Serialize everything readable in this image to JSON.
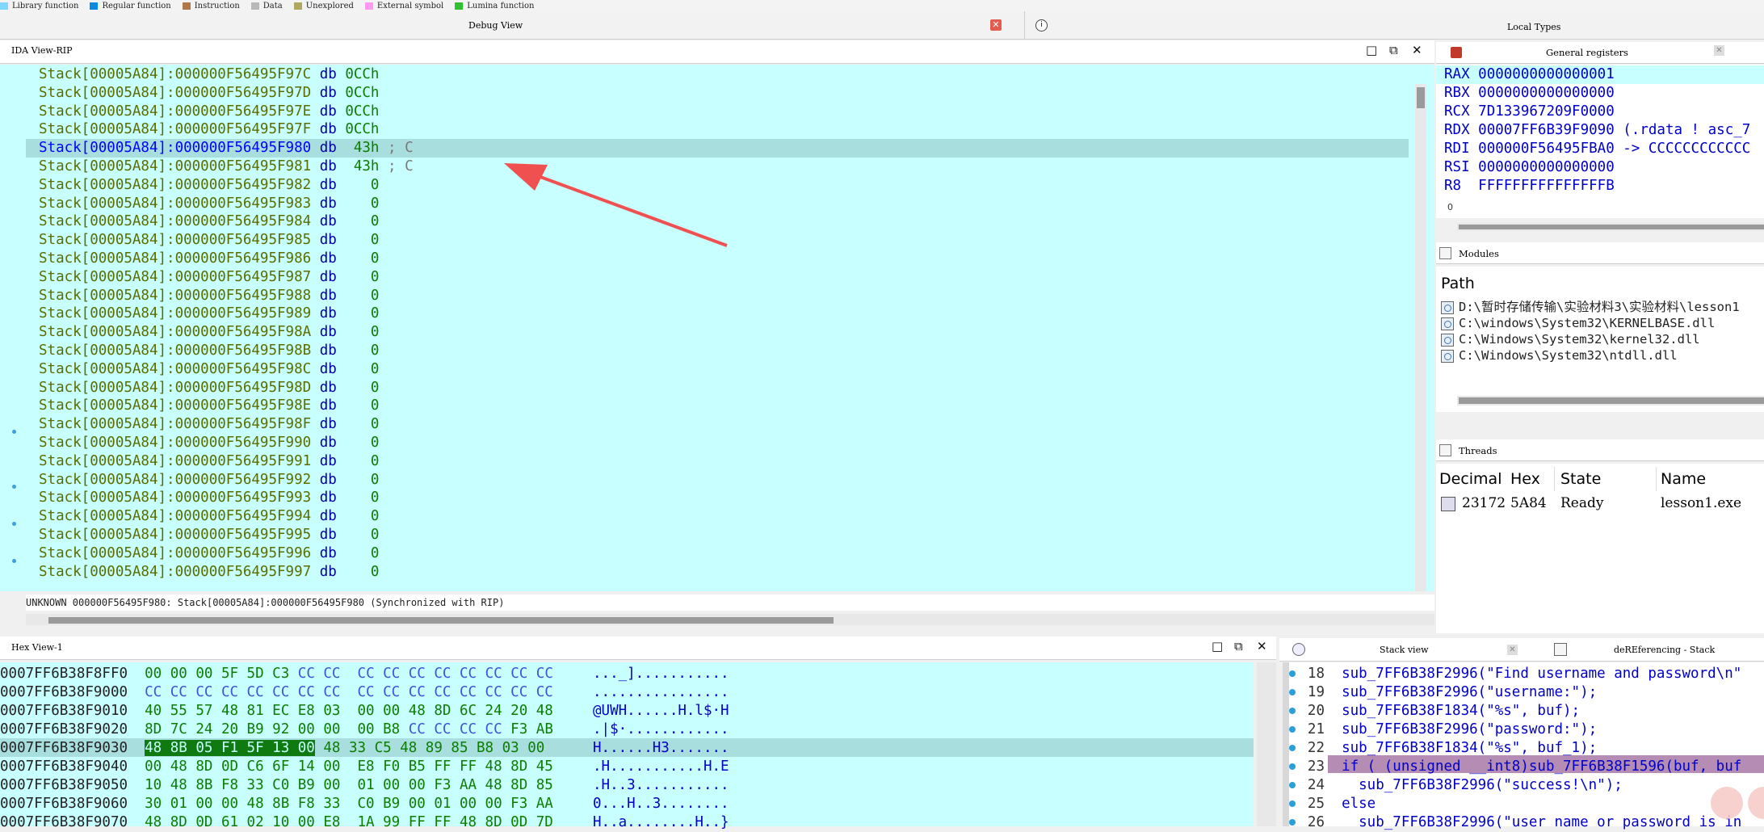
{
  "legend": [
    {
      "label": "Library function",
      "color": "#7fd6ff"
    },
    {
      "label": "Regular function",
      "color": "#0a8ae0"
    },
    {
      "label": "Instruction",
      "color": "#b07848"
    },
    {
      "label": "Data",
      "color": "#b8b8b8"
    },
    {
      "label": "Unexplored",
      "color": "#b0a860"
    },
    {
      "label": "External symbol",
      "color": "#ff98f0"
    },
    {
      "label": "Lumina function",
      "color": "#30c030"
    }
  ],
  "tabs": {
    "debug_view": "Debug View",
    "local_types": "Local Types",
    "close_glyph": "✕"
  },
  "ida_view": {
    "title": "IDA View-RIP",
    "lines": [
      {
        "addr": "Stack[00005A84]:000000F56495F97C",
        "op": "db",
        "val": "0CCh",
        "cmt": ""
      },
      {
        "addr": "Stack[00005A84]:000000F56495F97D",
        "op": "db",
        "val": "0CCh",
        "cmt": ""
      },
      {
        "addr": "Stack[00005A84]:000000F56495F97E",
        "op": "db",
        "val": "0CCh",
        "cmt": ""
      },
      {
        "addr": "Stack[00005A84]:000000F56495F97F",
        "op": "db",
        "val": "0CCh",
        "cmt": ""
      },
      {
        "addr": "Stack[00005A84]:000000F56495F980",
        "op": "db",
        "val": " 43h",
        "cmt": " ; C"
      },
      {
        "addr": "Stack[00005A84]:000000F56495F981",
        "op": "db",
        "val": " 43h",
        "cmt": " ; C"
      },
      {
        "addr": "Stack[00005A84]:000000F56495F982",
        "op": "db",
        "val": "   0",
        "cmt": ""
      },
      {
        "addr": "Stack[00005A84]:000000F56495F983",
        "op": "db",
        "val": "   0",
        "cmt": ""
      },
      {
        "addr": "Stack[00005A84]:000000F56495F984",
        "op": "db",
        "val": "   0",
        "cmt": ""
      },
      {
        "addr": "Stack[00005A84]:000000F56495F985",
        "op": "db",
        "val": "   0",
        "cmt": ""
      },
      {
        "addr": "Stack[00005A84]:000000F56495F986",
        "op": "db",
        "val": "   0",
        "cmt": ""
      },
      {
        "addr": "Stack[00005A84]:000000F56495F987",
        "op": "db",
        "val": "   0",
        "cmt": ""
      },
      {
        "addr": "Stack[00005A84]:000000F56495F988",
        "op": "db",
        "val": "   0",
        "cmt": ""
      },
      {
        "addr": "Stack[00005A84]:000000F56495F989",
        "op": "db",
        "val": "   0",
        "cmt": ""
      },
      {
        "addr": "Stack[00005A84]:000000F56495F98A",
        "op": "db",
        "val": "   0",
        "cmt": ""
      },
      {
        "addr": "Stack[00005A84]:000000F56495F98B",
        "op": "db",
        "val": "   0",
        "cmt": ""
      },
      {
        "addr": "Stack[00005A84]:000000F56495F98C",
        "op": "db",
        "val": "   0",
        "cmt": ""
      },
      {
        "addr": "Stack[00005A84]:000000F56495F98D",
        "op": "db",
        "val": "   0",
        "cmt": ""
      },
      {
        "addr": "Stack[00005A84]:000000F56495F98E",
        "op": "db",
        "val": "   0",
        "cmt": ""
      },
      {
        "addr": "Stack[00005A84]:000000F56495F98F",
        "op": "db",
        "val": "   0",
        "cmt": ""
      },
      {
        "addr": "Stack[00005A84]:000000F56495F990",
        "op": "db",
        "val": "   0",
        "cmt": ""
      },
      {
        "addr": "Stack[00005A84]:000000F56495F991",
        "op": "db",
        "val": "   0",
        "cmt": ""
      },
      {
        "addr": "Stack[00005A84]:000000F56495F992",
        "op": "db",
        "val": "   0",
        "cmt": ""
      },
      {
        "addr": "Stack[00005A84]:000000F56495F993",
        "op": "db",
        "val": "   0",
        "cmt": ""
      },
      {
        "addr": "Stack[00005A84]:000000F56495F994",
        "op": "db",
        "val": "   0",
        "cmt": ""
      },
      {
        "addr": "Stack[00005A84]:000000F56495F995",
        "op": "db",
        "val": "   0",
        "cmt": ""
      },
      {
        "addr": "Stack[00005A84]:000000F56495F996",
        "op": "db",
        "val": "   0",
        "cmt": ""
      },
      {
        "addr": "Stack[00005A84]:000000F56495F997",
        "op": "db",
        "val": "   0",
        "cmt": ""
      }
    ],
    "status": "UNKNOWN 000000F56495F980: Stack[00005A84]:000000F56495F980 (Synchronized with RIP)"
  },
  "registers": {
    "title": "General registers",
    "rows": [
      {
        "name": "RAX",
        "value": "0000000000000001",
        "comment": ""
      },
      {
        "name": "RBX",
        "value": "0000000000000000",
        "comment": ""
      },
      {
        "name": "RCX",
        "value": "7D133967209F0000",
        "comment": ""
      },
      {
        "name": "RDX",
        "value": "00007FF6B39F9090",
        "comment": " (.rdata ! asc_7"
      },
      {
        "name": "RDI",
        "value": "000000F56495FBA0",
        "comment": " -> CCCCCCCCCCCC"
      },
      {
        "name": "RSI",
        "value": "0000000000000000",
        "comment": ""
      },
      {
        "name": "R8 ",
        "value": "FFFFFFFFFFFFFFFB",
        "comment": ""
      }
    ],
    "footer": "0"
  },
  "modules": {
    "title": "Modules",
    "header": "Path",
    "paths": [
      "D:\\暂时存储传输\\实验材料3\\实验材料\\lesson1",
      "C:\\windows\\System32\\KERNELBASE.dll",
      "C:\\Windows\\System32\\kernel32.dll",
      "C:\\Windows\\System32\\ntdll.dll"
    ]
  },
  "threads": {
    "title": "Threads",
    "headers": [
      "Decimal",
      "Hex",
      "State",
      "Name"
    ],
    "row": {
      "decimal": "23172",
      "hex": "5A84",
      "state": "Ready",
      "name": "lesson1.exe"
    }
  },
  "hex_view": {
    "title": "Hex View-1",
    "rows": [
      {
        "addr": "0007FF6B38F8FF0",
        "b1": "00 00 00 5F 5D C3",
        "b2": " CC CC ",
        "b3": " CC CC CC CC CC CC CC CC",
        "asc": "..._]..........."
      },
      {
        "addr": "0007FF6B38F9000",
        "b1": "",
        "b2": "CC CC CC CC CC CC CC CC  CC CC CC CC CC CC CC CC",
        "b3": "",
        "asc": "................"
      },
      {
        "addr": "0007FF6B38F9010",
        "b1": "40 55 57 48 81 EC E8 03  00 00 48 8D 6C 24 20 48",
        "b2": "",
        "b3": "",
        "asc": "@UWH......H.l$·H"
      },
      {
        "addr": "0007FF6B38F9020",
        "b1": "8D 7C 24 20 B9 92 00 00  00 B8",
        "b2": " CC CC CC CC",
        "b3": " F3 AB",
        "asc": ".|$·............"
      },
      {
        "addr": "0007FF6B38F9030",
        "b1": "",
        "b2": "",
        "b3": " 48 33 C5 48 89 85 B8 03 00",
        "asc": "H......H3......."
      },
      {
        "addr": "0007FF6B38F9040",
        "b1": "00 48 8D 0D C6 6F 14 00  E8 F0 B5 FF FF 48 8D 45",
        "b2": "",
        "b3": "",
        "asc": ".H...........H.E"
      },
      {
        "addr": "0007FF6B38F9050",
        "b1": "10 48 8B F8 33 C0 B9 00  01 00 00 F3 AA 48 8D 85",
        "b2": "",
        "b3": "",
        "asc": ".H..3..........."
      },
      {
        "addr": "0007FF6B38F9060",
        "b1": "30 01 00 00 48 8B F8 33  C0 B9 00 01 00 00 F3 AA",
        "b2": "",
        "b3": "",
        "asc": "0...H..3........"
      },
      {
        "addr": "0007FF6B38F9070",
        "b1": "48 8D 0D 61 02 10 00 E8  1A 99 FF FF 48 8D 0D 7D",
        "b2": "",
        "b3": "",
        "asc": "H..a........H..}"
      }
    ],
    "selected_bytes": "48 8B 05 F1 5F 13 00"
  },
  "bottom_tabs": {
    "stack_view": "Stack view",
    "deref": "deREferencing - Stack"
  },
  "pseudocode": {
    "lines": [
      {
        "num": "18",
        "text": "sub_7FF6B38F2996(\"Find username and password\\n\""
      },
      {
        "num": "19",
        "text": "sub_7FF6B38F2996(\"username:\");"
      },
      {
        "num": "20",
        "text": "sub_7FF6B38F1834(\"%s\", buf);"
      },
      {
        "num": "21",
        "text": "sub_7FF6B38F2996(\"password:\");"
      },
      {
        "num": "22",
        "text": "sub_7FF6B38F1834(\"%s\", buf_1);"
      },
      {
        "num": "23",
        "text": "if ( (unsigned __int8)sub_7FF6B38F1596(buf, buf"
      },
      {
        "num": "24",
        "text": "  sub_7FF6B38F2996(\"success!\\n\");"
      },
      {
        "num": "25",
        "text": "else"
      },
      {
        "num": "26",
        "text": "  sub_7FF6B38F2996(\"user name or password is in"
      }
    ]
  }
}
